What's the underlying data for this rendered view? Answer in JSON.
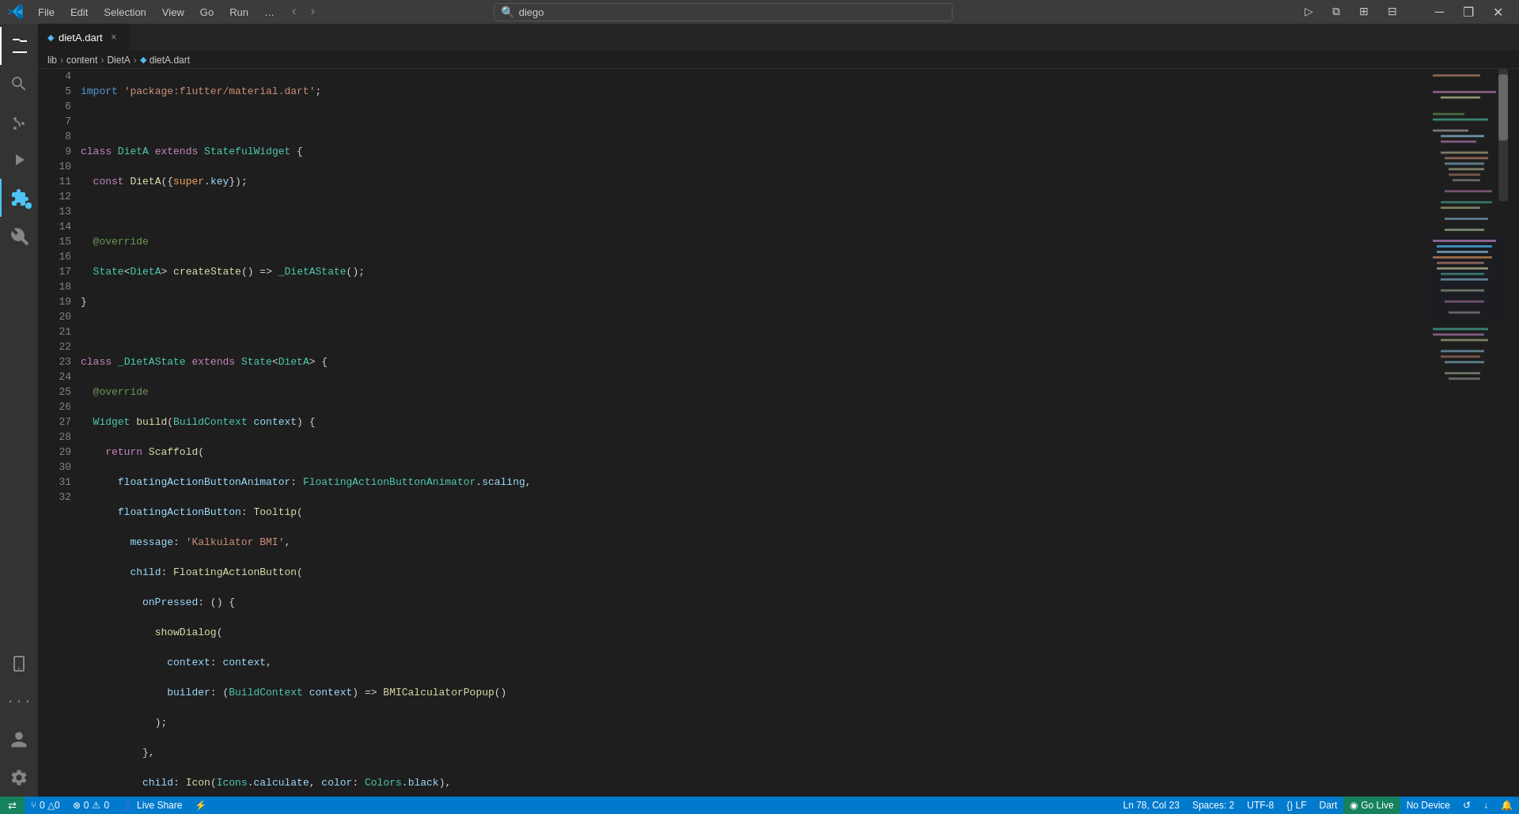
{
  "titlebar": {
    "logo_label": "VS Code",
    "menu_items": [
      "File",
      "Edit",
      "Selection",
      "View",
      "Go",
      "Run"
    ],
    "dots_label": "…",
    "back_label": "‹",
    "forward_label": "›",
    "search_placeholder": "diego",
    "actions": [
      "▷",
      "⧉",
      "⋯",
      "─",
      "❐",
      "✕"
    ]
  },
  "tab": {
    "filename": "dietA.dart",
    "icon_color": "#53baf6",
    "close_label": "×"
  },
  "breadcrumb": {
    "parts": [
      "lib",
      "content",
      "DietA",
      "dietA.dart"
    ],
    "separators": [
      ">",
      ">",
      ">"
    ]
  },
  "editor": {
    "lines": [
      {
        "num": 4,
        "code": "import_line"
      },
      {
        "num": 5,
        "code": "empty"
      },
      {
        "num": 6,
        "code": "class_dieta"
      },
      {
        "num": 7,
        "code": "const_dieta"
      },
      {
        "num": 8,
        "code": "empty"
      },
      {
        "num": 9,
        "code": "override"
      },
      {
        "num": 10,
        "code": "create_state"
      },
      {
        "num": 11,
        "code": "close_brace"
      },
      {
        "num": 12,
        "code": "empty"
      },
      {
        "num": 13,
        "code": "class_dieta_state"
      },
      {
        "num": 14,
        "code": "override2"
      },
      {
        "num": 15,
        "code": "widget_build"
      },
      {
        "num": 16,
        "code": "return_scaffold"
      },
      {
        "num": 17,
        "code": "floating_animator"
      },
      {
        "num": 18,
        "code": "floating_button"
      },
      {
        "num": 19,
        "code": "message"
      },
      {
        "num": 20,
        "code": "child_fab"
      },
      {
        "num": 21,
        "code": "on_pressed"
      },
      {
        "num": 22,
        "code": "show_dialog"
      },
      {
        "num": 23,
        "code": "context_param"
      },
      {
        "num": 24,
        "code": "builder_param"
      },
      {
        "num": 25,
        "code": "close_paren_semi"
      },
      {
        "num": 26,
        "code": "close_brace_comma"
      },
      {
        "num": 27,
        "code": "child_icon"
      },
      {
        "num": 28,
        "code": "background_color"
      },
      {
        "num": 29,
        "code": "close_paren_comma"
      },
      {
        "num": 30,
        "code": "close_paren_comma2"
      },
      {
        "num": 31,
        "code": "bg_color"
      },
      {
        "num": 32,
        "code": "body_single"
      }
    ]
  },
  "status_bar": {
    "git_icon": "⑂",
    "git_branch": "0 △0",
    "errors_icon": "⊗",
    "errors": "0",
    "warnings_icon": "⚠",
    "warnings": "0",
    "live_share_icon": "👤",
    "live_share": "Live Share",
    "lightning": "⚡",
    "ln_col": "Ln 78, Col 23",
    "spaces": "Spaces: 2",
    "encoding": "UTF-8",
    "eol": "{}",
    "language": "Dart",
    "go_live_icon": "◉",
    "go_live": "Go Live",
    "no_device": "No Device",
    "icons_right": [
      "↺",
      "↓",
      "🔔"
    ]
  }
}
